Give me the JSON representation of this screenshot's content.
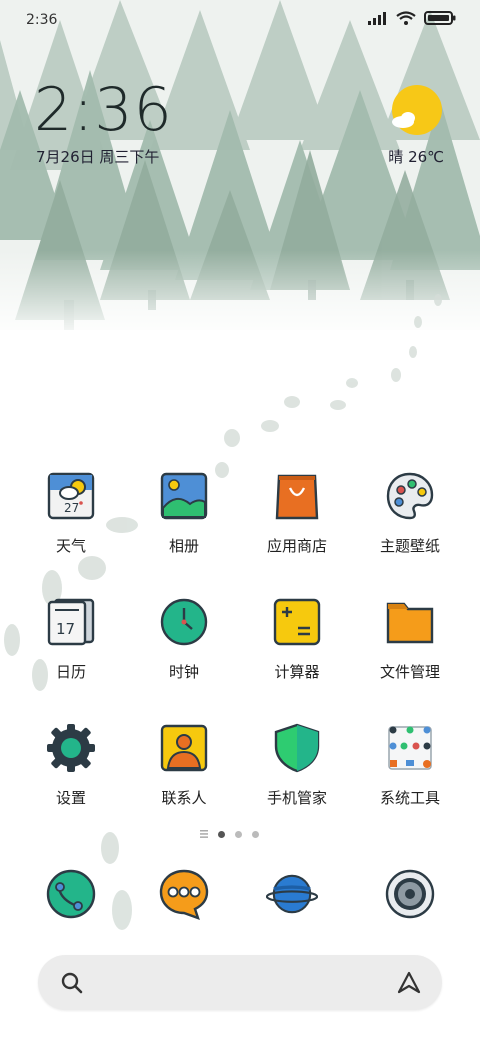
{
  "status_bar": {
    "time": "2:36",
    "icons": [
      "signal-icon",
      "wifi-icon",
      "battery-icon"
    ]
  },
  "lock_widget": {
    "time": "2:36",
    "date": "7月26日 周三下午"
  },
  "weather": {
    "text": "晴 26℃",
    "icon": "sunny-cloud-icon"
  },
  "apps": [
    {
      "label": "天气",
      "icon": "weather-icon"
    },
    {
      "label": "相册",
      "icon": "gallery-icon"
    },
    {
      "label": "应用商店",
      "icon": "app-store-icon"
    },
    {
      "label": "主题壁纸",
      "icon": "themes-icon"
    },
    {
      "label": "日历",
      "icon": "calendar-icon"
    },
    {
      "label": "时钟",
      "icon": "clock-icon"
    },
    {
      "label": "计算器",
      "icon": "calculator-icon"
    },
    {
      "label": "文件管理",
      "icon": "file-manager-icon"
    },
    {
      "label": "设置",
      "icon": "settings-icon"
    },
    {
      "label": "联系人",
      "icon": "contacts-icon"
    },
    {
      "label": "手机管家",
      "icon": "security-icon"
    },
    {
      "label": "系统工具",
      "icon": "tools-folder-icon"
    }
  ],
  "weather_icon_day": "27",
  "calendar_icon_day": "17",
  "page_indicator": {
    "pages": 3,
    "current": 1
  },
  "dock": [
    "phone-icon",
    "messages-icon",
    "browser-icon",
    "camera-icon"
  ],
  "search_bar": {
    "left_icon": "search-icon",
    "right_icon": "assistant-icon"
  },
  "colors": {
    "tree": "#a9bfb4",
    "accent_yellow": "#f6c90e",
    "background": "#ffffff"
  }
}
